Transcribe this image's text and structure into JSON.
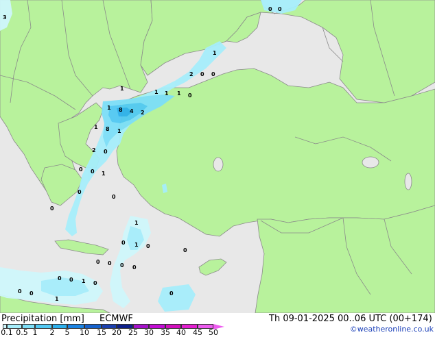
{
  "title": "Precipitation [mm]",
  "model": "ECMWF",
  "datetime": "Th 09-01-2025 00..06 UTC (00+174)",
  "credit": "©weatheronline.co.uk",
  "legend": {
    "ticks": [
      "0.1",
      "0.5",
      "1",
      "2",
      "5",
      "10",
      "15",
      "20",
      "25",
      "30",
      "35",
      "40",
      "45",
      "50"
    ],
    "colors": [
      "#cff7fc",
      "#a6eefb",
      "#7ddff8",
      "#52c9f3",
      "#2db0ec",
      "#1a83e3",
      "#1561cc",
      "#1a3fae",
      "#0d1f8a",
      "#a512c9",
      "#c30dd4",
      "#d20fbc",
      "#e31fd0",
      "#ed5bef"
    ]
  },
  "colors": {
    "land": "#b8f29c",
    "sea_outside": "#e8e8e8",
    "border": "#8a8a8a"
  },
  "map_values": [
    "3",
    "0",
    "0",
    "1",
    "2",
    "0",
    "0",
    "1",
    "1",
    "1",
    "1",
    "0",
    "1",
    "8",
    "4",
    "2",
    "1",
    "8",
    "1",
    "2",
    "0",
    "0",
    "0",
    "1",
    "0",
    "0",
    "0",
    "1",
    "0",
    "1",
    "0",
    "0",
    "0",
    "0",
    "0",
    "0",
    "0",
    "0",
    "1",
    "0",
    "0",
    "0",
    "0",
    "1"
  ]
}
